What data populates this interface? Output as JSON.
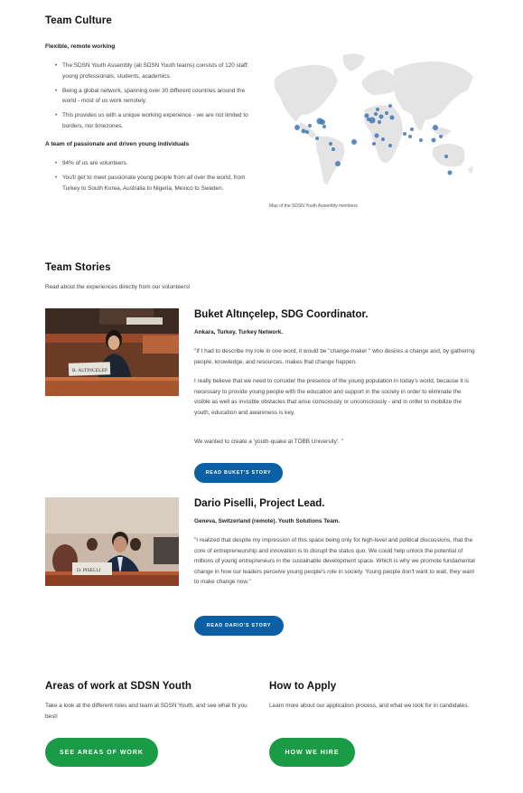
{
  "culture": {
    "title": "Team Culture",
    "remote_heading": "Flexible, remote working",
    "remote_bullets": [
      "The SDSN Youth Assembly (all SDSN Youth teams) consists of 120 staff: young professionals, students, academics.",
      "Being a global network, spanning over 30 different countries around the world - most of us work remotely.",
      "This provides us with a unique working experience - we are not limited to borders, nor timezones."
    ],
    "team_heading": "A team of passionate and driven young individuals",
    "team_bullets": [
      "94% of us are volunteers.",
      "You'll get to meet passionate young people from all over the world, from Turkey to South Korea, Australia to Nigeria, Mexico to Sweden."
    ],
    "map_caption": "Map of the SDSN Youth Assembly members"
  },
  "stories": {
    "title": "Team Stories",
    "intro": "Read about the experiences directly from our volunteers!",
    "items": [
      {
        "name": "Buket Altınçelep, SDG Coordinator.",
        "location": "Ankara, Turkey. Turkey Network.",
        "paragraphs": [
          "\"If I had to describe my role in one word, it would be \"change-maker \" who desires a change and, by gathering people, knowledge, and resources, makes that change happen.",
          "I really believe that we need to consider the presence of the young population in today's world, because it is necessary to provide young people with the education and support in the society in order to eliminate the visible as well as invisible obstacles that arise consciously or unconsciously - and in order to mobilize the youth, education and awareness is key.",
          "We wanted to create a 'youth-quake at TOBB University'. \""
        ],
        "button": "READ BUKET'S STORY",
        "nameplate": "B. ALTINCELEP"
      },
      {
        "name": "Dario Piselli, Project Lead.",
        "location": "Geneva, Switzerland (remote). Youth Solutions Team.",
        "paragraphs": [
          "\"I realized that despite my impression of this space being only for high-level and political discussions, that the core of entrepreneurship and innovation is to disrupt the status quo. We could help unlock the potential of millions of young entrepreneurs in the sustainable development space. Which is why we promote fundamental change in how our leaders perceive young people's role in society. Young people don't want to wait, they want to make change now.\""
        ],
        "button": "READ DARIO'S STORY",
        "nameplate": "D. PISELLI"
      }
    ]
  },
  "areas": {
    "title": "Areas of work at SDSN Youth",
    "text": "Take a look at the different roles and team at SDSN Youth, and see what fit you best!",
    "button": "SEE AREAS OF WORK"
  },
  "apply": {
    "title": "How to Apply",
    "text": "Learn more about our application process, and what we look for in candidates.",
    "button": "HOW WE HIRE"
  },
  "colors": {
    "blue_button": "#0b5fa5",
    "green_button": "#1a9b46",
    "map_land": "#e3e3e3",
    "map_dot": "#3f77b5"
  }
}
